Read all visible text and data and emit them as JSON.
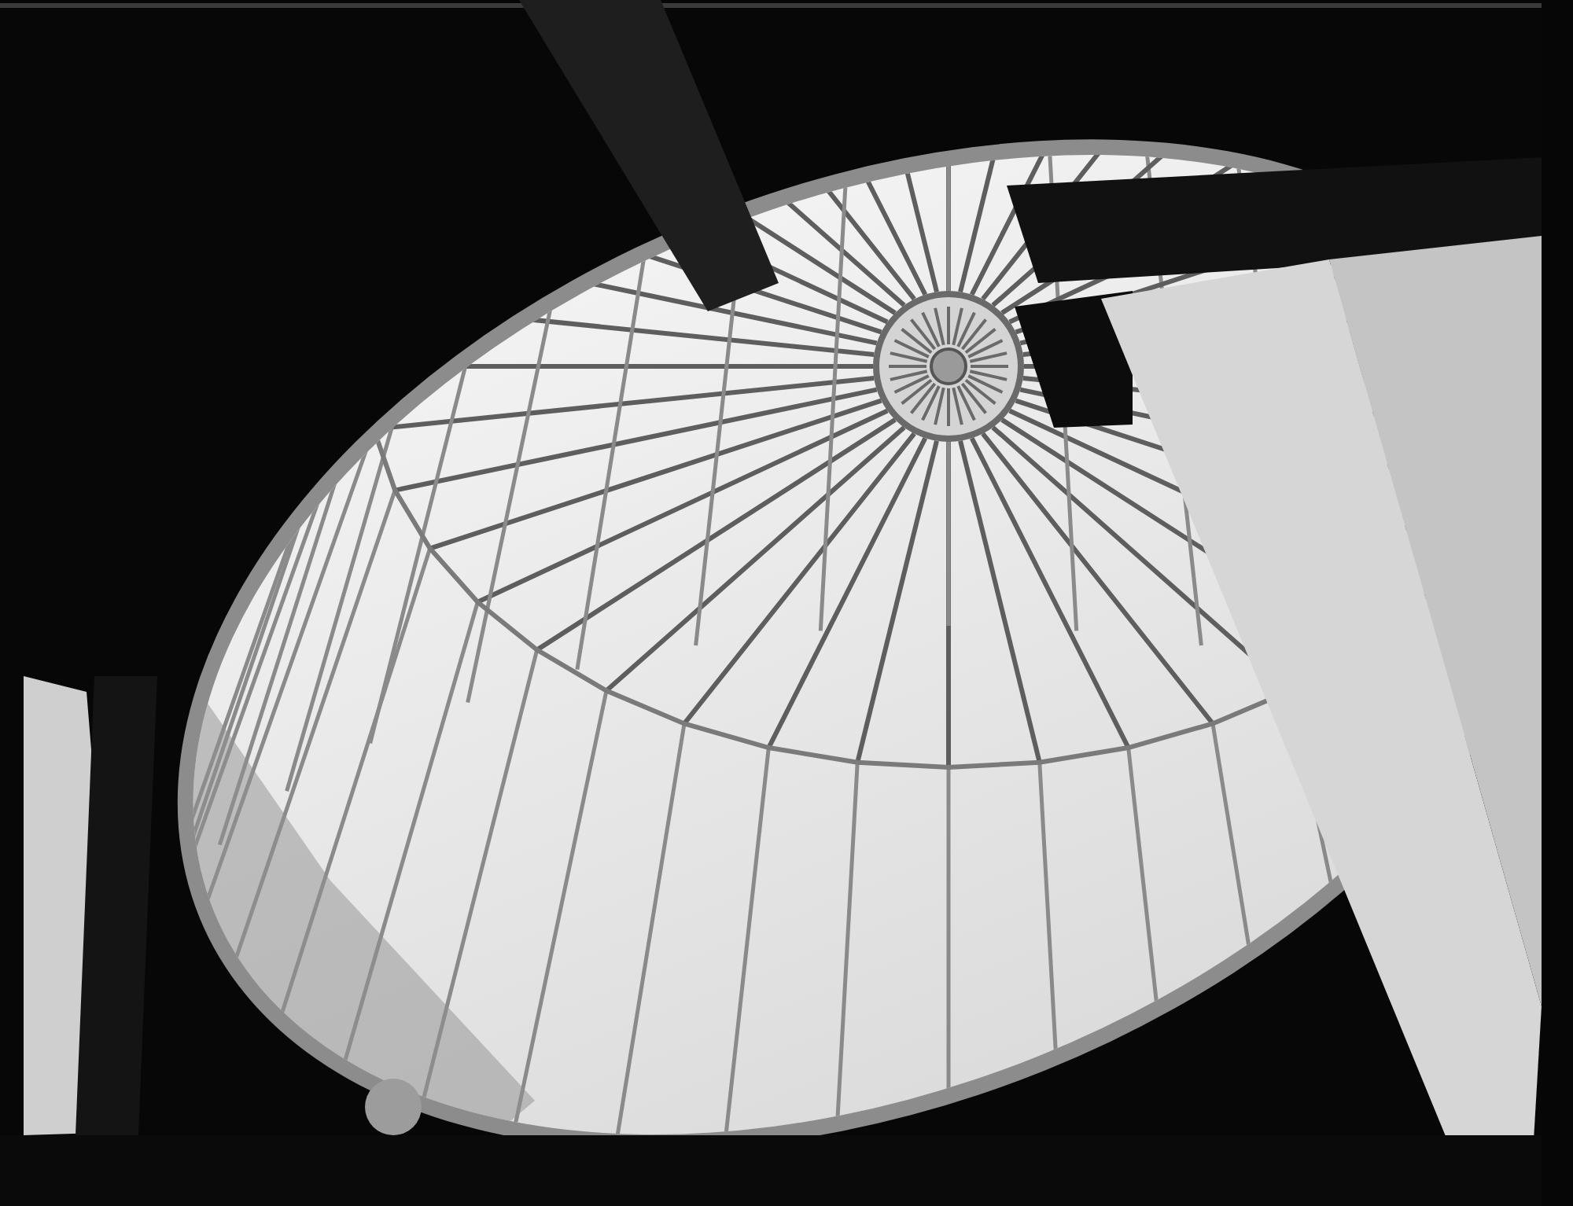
{
  "photo": {
    "kind": "photo"
  }
}
